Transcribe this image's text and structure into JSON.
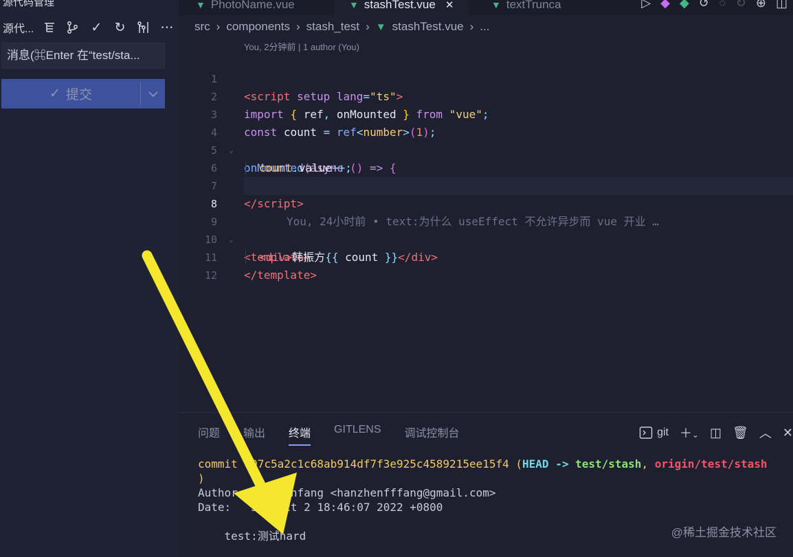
{
  "sidebar": {
    "title": "源代码管理",
    "toolbar_label": "源代...",
    "toolbar_icons": [
      "list-tree-icon",
      "branch-graph-icon",
      "check-icon",
      "refresh-icon",
      "git-fork-icon",
      "more-icon"
    ],
    "commit_placeholder": "消息(⌘Enter 在“test/sta...",
    "commit_button": "提交"
  },
  "tabs": [
    {
      "label": "PhotoName.vue",
      "active": false
    },
    {
      "label": "stashTest.vue",
      "active": true
    },
    {
      "label": "textTrunca",
      "active": false
    }
  ],
  "breadcrumb": [
    "src",
    "components",
    "stash_test",
    "stashTest.vue",
    "..."
  ],
  "editor": {
    "codelens": "You, 2分钟前 | 1 author (You)",
    "current_line": 8,
    "blame": "You, 24小时前 • text:为什么 useEffect 不允许异步而 vue 开业 …",
    "line_numbers": [
      "1",
      "2",
      "3",
      "4",
      "5",
      "6",
      "7",
      "8",
      "9",
      "10",
      "11",
      "12"
    ]
  },
  "panel": {
    "tabs": [
      "问题",
      "输出",
      "终端",
      "GITLENS",
      "调试控制台"
    ],
    "active_tab": "终端",
    "terminal_name": "git",
    "terminal": {
      "commit_word": "commit",
      "hash": "e07c5a2c1c68ab914df7f3e925c4589215ee15f4",
      "head": "HEAD",
      "arrow": "->",
      "branch": "test/stash",
      "remote": "origin/test/stash",
      "close_paren": ")",
      "author_label": "Author:",
      "author_value": "hanzhenfang <hanzhenfffang@gmail.com>",
      "date_label": "Date:",
      "date_value": "Sun Oct 2 18:46:07 2022 +0800",
      "message": "test:测试hard"
    }
  },
  "watermark": "@稀土掘金技术社区",
  "colors": {
    "accent": "#8d9cff",
    "commit_button": "#3e519c",
    "arrow": "#f5e62e"
  }
}
